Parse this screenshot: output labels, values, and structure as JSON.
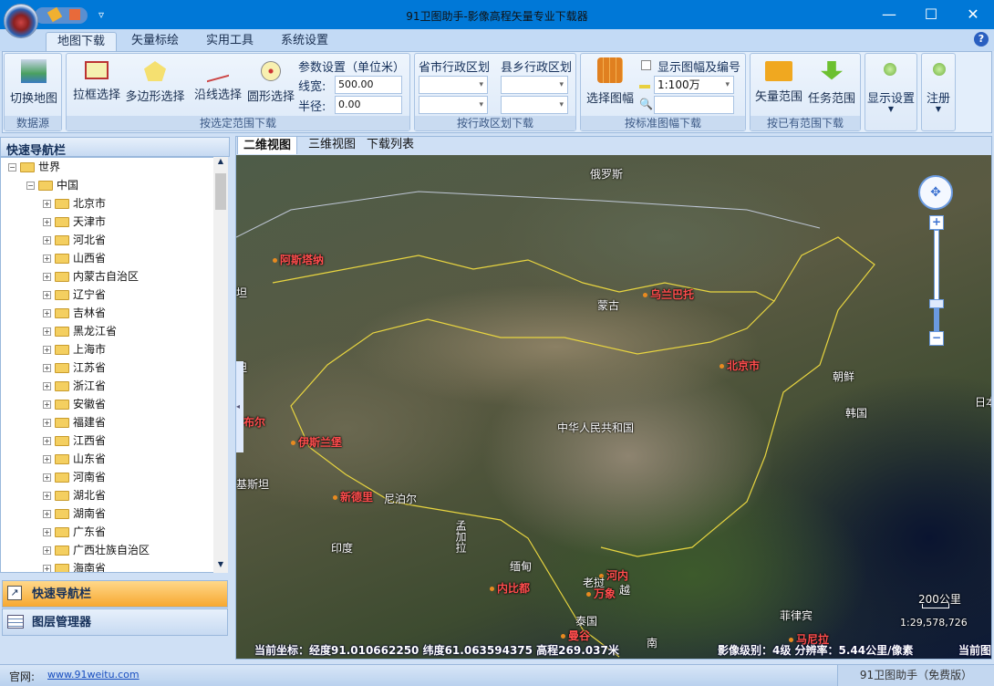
{
  "window": {
    "title": "91卫图助手-影像高程矢量专业下载器",
    "minimize": "—",
    "maximize": "☐",
    "close": "✕",
    "help": "?",
    "qat_more": "▿"
  },
  "tabs": [
    "地图下载",
    "矢量标绘",
    "实用工具",
    "系统设置"
  ],
  "ribbon": {
    "datasource": {
      "button": "切换地图",
      "group": "数据源"
    },
    "select": {
      "rect": "拉框选择",
      "polygon": "多边形选择",
      "line": "沿线选择",
      "circle": "圆形选择",
      "params_title": "参数设置（单位米）",
      "width_label": "线宽:",
      "width_value": "500.00",
      "radius_label": "半径:",
      "radius_value": "0.00",
      "group": "按选定范围下载"
    },
    "admin": {
      "province_label": "省市行政区划",
      "county_label": "县乡行政区划",
      "group": "按行政区划下载"
    },
    "sheet": {
      "button": "选择图幅",
      "show_checkbox": "显示图幅及编号",
      "scale": "1:100万",
      "group": "按标准图幅下载"
    },
    "existing": {
      "vector": "矢量范围",
      "task": "任务范围",
      "group": "按已有范围下载"
    },
    "display": "显示设置",
    "register": "注册"
  },
  "sidebar": {
    "title": "快速导航栏",
    "root": "世界",
    "country": "中国",
    "provinces": [
      "北京市",
      "天津市",
      "河北省",
      "山西省",
      "内蒙古自治区",
      "辽宁省",
      "吉林省",
      "黑龙江省",
      "上海市",
      "江苏省",
      "浙江省",
      "安徽省",
      "福建省",
      "江西省",
      "山东省",
      "河南省",
      "湖北省",
      "湖南省",
      "广东省",
      "广西壮族自治区",
      "海南省"
    ],
    "nav_button": "快速导航栏",
    "layer_button": "图层管理器"
  },
  "map": {
    "tabs": [
      "二维视图",
      "三维视图",
      "下载列表"
    ],
    "labels": [
      {
        "text": "俄罗斯",
        "cap": false
      },
      {
        "text": "阿斯塔纳",
        "cap": true
      },
      {
        "text": "坦",
        "cap": false
      },
      {
        "text": "蒙古",
        "cap": false
      },
      {
        "text": "乌兰巴托",
        "cap": true
      },
      {
        "text": "北京市",
        "cap": true
      },
      {
        "text": "朝鲜",
        "cap": false
      },
      {
        "text": "韩国",
        "cap": false
      },
      {
        "text": "日本",
        "cap": false
      },
      {
        "text": "坦",
        "cap": false
      },
      {
        "text": "布尔",
        "cap": true
      },
      {
        "text": "伊斯兰堡",
        "cap": true
      },
      {
        "text": "中华人民共和国",
        "cap": false
      },
      {
        "text": "基斯坦",
        "cap": false
      },
      {
        "text": "新德里",
        "cap": true
      },
      {
        "text": "尼泊尔",
        "cap": false
      },
      {
        "text": "印度",
        "cap": false
      },
      {
        "text": "孟加拉",
        "cap": false
      },
      {
        "text": "缅甸",
        "cap": false
      },
      {
        "text": "内比都",
        "cap": true
      },
      {
        "text": "河内",
        "cap": true
      },
      {
        "text": "老挝",
        "cap": false
      },
      {
        "text": "万象",
        "cap": true
      },
      {
        "text": "越",
        "cap": false
      },
      {
        "text": "泰国",
        "cap": false
      },
      {
        "text": "曼谷",
        "cap": true
      },
      {
        "text": "菲律宾",
        "cap": false
      },
      {
        "text": "马尼拉",
        "cap": true
      },
      {
        "text": "南",
        "cap": false
      }
    ],
    "scale_bar": "200公里",
    "scale_ratio": "1:29,578,726",
    "coords": "当前坐标：经度91.010662250 纬度61.063594375 高程269.037米",
    "level": "影像级别：4级 分辨率：5.44公里/像素",
    "current": "当前图"
  },
  "statusbar": {
    "site_label": "官网:",
    "site_link": "www.91weitu.com",
    "edition": "91卫图助手（免费版）"
  }
}
